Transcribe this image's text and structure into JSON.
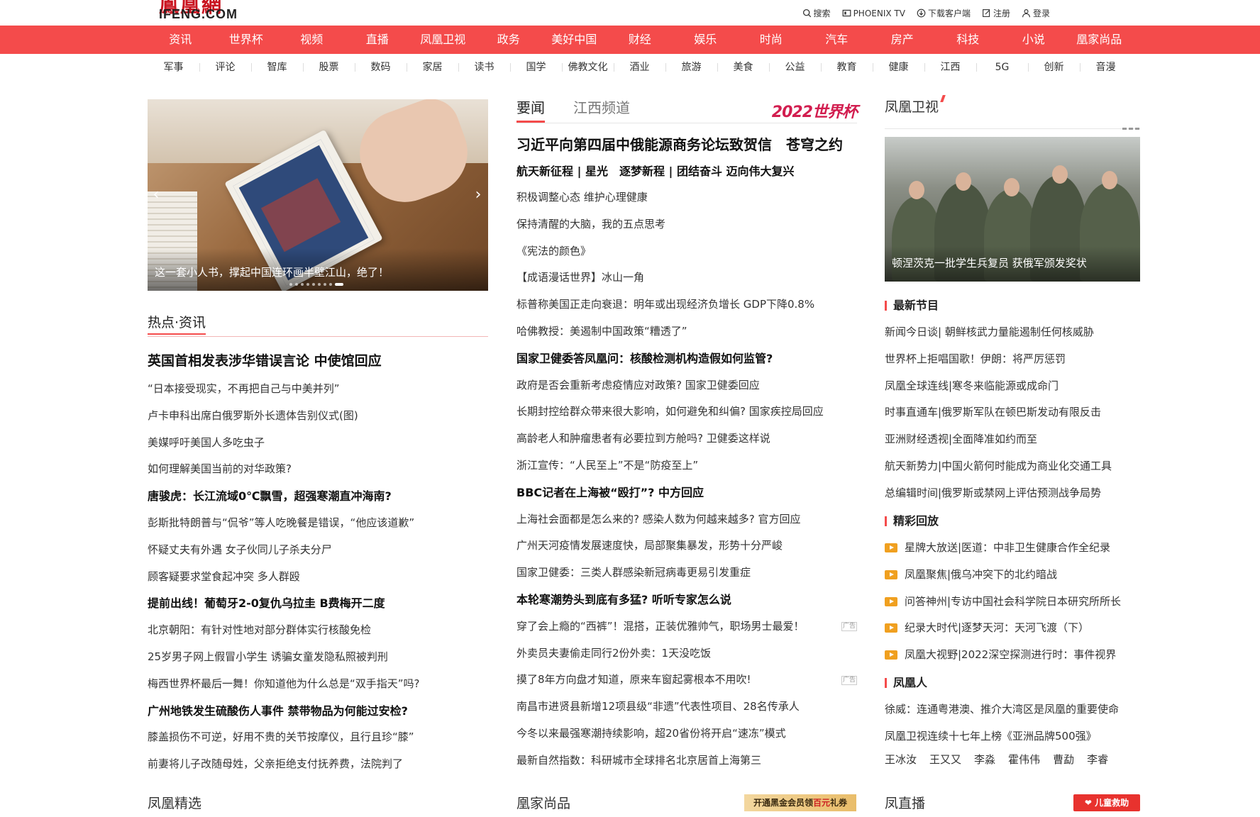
{
  "brand": {
    "logo_cn": "鳳凰網",
    "logo_en": "IFENG.COM",
    "accent": "#f44b4b"
  },
  "toplinks": [
    {
      "icon": "search-icon",
      "label": "搜索"
    },
    {
      "icon": "tv-icon",
      "label": "PHOENIX TV"
    },
    {
      "icon": "download-icon",
      "label": "下载客户端"
    },
    {
      "icon": "edit-icon",
      "label": "注册"
    },
    {
      "icon": "user-icon",
      "label": "登录"
    }
  ],
  "mainnav": [
    "资讯",
    "世界杯",
    "视频",
    "直播",
    "凤凰卫视",
    "政务",
    "美好中国",
    "财经",
    "娱乐",
    "时尚",
    "汽车",
    "房产",
    "科技",
    "小说",
    "凰家尚品"
  ],
  "subnav": [
    "军事",
    "评论",
    "智库",
    "股票",
    "数码",
    "家居",
    "读书",
    "国学",
    "佛教文化",
    "酒业",
    "旅游",
    "美食",
    "公益",
    "教育",
    "健康",
    "江西",
    "5G",
    "创新",
    "音漫"
  ],
  "slider": {
    "caption": "这一套小人书，撑起中国连环画半壁江山，绝了！",
    "prev": "‹",
    "next": "›",
    "active_slide": 8
  },
  "hot": {
    "title": "热点·资讯",
    "items": [
      {
        "text": "英国首相发表涉华错误言论 中使馆回应",
        "style": "big"
      },
      {
        "text": "“日本接受现实，不再把自己与中美并列”",
        "style": ""
      },
      {
        "text": "卢卡申科出席白俄罗斯外长遗体告别仪式(图)",
        "style": ""
      },
      {
        "text": "美媒呼吁美国人多吃虫子",
        "style": ""
      },
      {
        "text": "如何理解美国当前的对华政策?",
        "style": ""
      },
      {
        "text": "唐骏虎：长江流域0℃飘雪，超强寒潮直冲海南?",
        "style": "bold"
      },
      {
        "text": "彭斯批特朗普与“侃爷”等人吃晚餐是错误，“他应该道歉”",
        "style": ""
      },
      {
        "text": "怀疑丈夫有外遇 女子伙同儿子杀夫分尸",
        "style": ""
      },
      {
        "text": "顾客疑要求堂食起冲突 多人群殴",
        "style": ""
      },
      {
        "text": "提前出线！葡萄牙2-0复仇乌拉圭 B费梅开二度",
        "style": "bold"
      },
      {
        "text": "北京朝阳：有针对性地对部分群体实行核酸免检",
        "style": ""
      },
      {
        "text": "25岁男子网上假冒小学生 诱骗女童发隐私照被判刑",
        "style": ""
      },
      {
        "text": "梅西世界杯最后一舞！你知道他为什么总是“双手指天”吗?",
        "style": ""
      },
      {
        "text": "广州地铁发生硫酸伤人事件 禁带物品为何能过安检?",
        "style": "bold"
      },
      {
        "text": "膝盖损伤不可逆，好用不贵的关节按摩仪，且行且珍“膝”",
        "style": ""
      },
      {
        "text": "前妻将儿子改随母姓，父亲拒绝支付抚养费，法院判了",
        "style": ""
      }
    ]
  },
  "news": {
    "tab_active": "要闻",
    "tab_inactive": "江西频道",
    "wc_logo": "2022世界杯",
    "headline": "习近平向第四届中俄能源商务论坛致贺信　苍穹之约",
    "subhead": "航天新征程 | 星光　逐梦新程 | 团结奋斗 迈向伟大复兴",
    "ad_label": "广告",
    "items": [
      {
        "text": "积极调整心态 维护心理健康",
        "style": ""
      },
      {
        "text": "保持清醒的大脑，我的五点思考",
        "style": ""
      },
      {
        "text": "《宪法的颜色》",
        "style": ""
      },
      {
        "text": "【成语漫话世界】冰山一角",
        "style": ""
      },
      {
        "text": "标普称美国正走向衰退：明年或出现经济负增长 GDP下降0.8%",
        "style": ""
      },
      {
        "text": "哈佛教授：美遏制中国政策“糟透了”",
        "style": ""
      },
      {
        "text": "国家卫健委答凤凰问：核酸检测机构造假如何监管?",
        "style": "bold"
      },
      {
        "text": "政府是否会重新考虑疫情应对政策? 国家卫健委回应",
        "style": ""
      },
      {
        "text": "长期封控给群众带来很大影响，如何避免和纠偏? 国家疾控局回应",
        "style": ""
      },
      {
        "text": "高龄老人和肿瘤患者有必要拉到方舱吗? 卫健委这样说",
        "style": ""
      },
      {
        "text": "浙江宣传：“人民至上”不是“防疫至上”",
        "style": ""
      },
      {
        "text": "BBC记者在上海被“殴打”? 中方回应",
        "style": "bold"
      },
      {
        "text": "上海社会面都是怎么来的? 感染人数为何越来越多? 官方回应",
        "style": ""
      },
      {
        "text": "广州天河疫情发展速度快，局部聚集暴发，形势十分严峻",
        "style": ""
      },
      {
        "text": "国家卫健委：三类人群感染新冠病毒更易引发重症",
        "style": ""
      },
      {
        "text": "本轮寒潮势头到底有多猛? 听听专家怎么说",
        "style": "bold"
      },
      {
        "text": "穿了会上瘾的“西裤”！混搭，正装优雅帅气，职场男士最爱！",
        "style": "",
        "ad": true
      },
      {
        "text": "外卖员夫妻偷走同行2份外卖：1天没吃饭",
        "style": ""
      },
      {
        "text": "摸了8年方向盘才知道，原来车窗起雾根本不用吹!",
        "style": "",
        "ad": true
      },
      {
        "text": "南昌市进贤县新增12项县级“非遗”代表性项目、28名传承人",
        "style": ""
      },
      {
        "text": "今冬以来最强寒潮持续影响，超20省份将开启“速冻”模式",
        "style": ""
      },
      {
        "text": "最新自然指数：科研城市全球排名北京居首上海第三",
        "style": ""
      }
    ]
  },
  "phoenix": {
    "title": "凤凰卫视",
    "image_caption": "顿涅茨克一批学生兵复员 获俄军颁发奖状",
    "latest_title": "最新节目",
    "latest": [
      "新闻今日谈| 朝鲜核武力量能遏制任何核威胁",
      "世界杯上拒唱国歌！伊朗：将严厉惩罚",
      "凤凰全球连线|寒冬来临能源或成命门",
      "时事直通车|俄罗斯军队在顿巴斯发动有限反击",
      "亚洲财经透视|全面降准如约而至",
      "航天新势力|中国火箭何时能成为商业化交通工具",
      "总编辑时间|俄罗斯或禁网上评估预测战争局势"
    ],
    "replay_title": "精彩回放",
    "replay": [
      "星牌大放送|医道：中非卫生健康合作全纪录",
      "凤凰聚焦|俄乌冲突下的北约暗战",
      "问答神州|专访中国社会科学院日本研究所所长",
      "纪录大时代|逐梦天河：天河飞渡（下）",
      "凤凰大视野|2022深空探测进行时：事件视界"
    ],
    "people_title": "凤凰人",
    "people": [
      "徐威：连通粤港澳、推介大湾区是凤凰的重要使命",
      "凤凰卫视连续十七年上榜《亚洲品牌500强》"
    ],
    "names": [
      "王冰汝",
      "王又又",
      "李淼",
      "霍伟伟",
      "曹勐",
      "李睿"
    ]
  },
  "bottom": {
    "left_title": "凤凰精选",
    "mid_title": "凰家尚品",
    "vip_prefix": "开通黑金会员领",
    "vip_highlight": "百元",
    "vip_suffix": "礼券",
    "right_title": "凤直播",
    "rescue_label": "儿童救助"
  }
}
